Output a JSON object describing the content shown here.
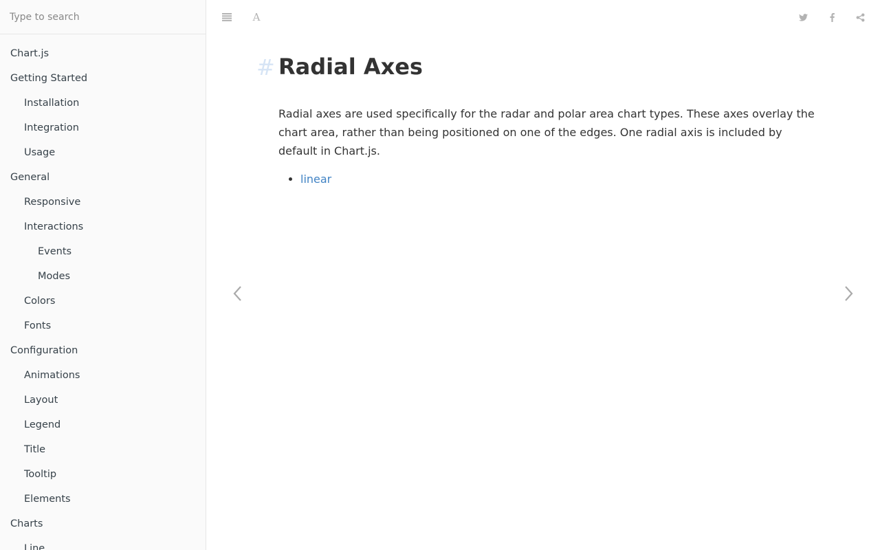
{
  "search": {
    "placeholder": "Type to search"
  },
  "sidebar": {
    "items": [
      {
        "label": "Chart.js",
        "level": 0
      },
      {
        "label": "Getting Started",
        "level": 0
      },
      {
        "label": "Installation",
        "level": 1
      },
      {
        "label": "Integration",
        "level": 1
      },
      {
        "label": "Usage",
        "level": 1
      },
      {
        "label": "General",
        "level": 0
      },
      {
        "label": "Responsive",
        "level": 1
      },
      {
        "label": "Interactions",
        "level": 1
      },
      {
        "label": "Events",
        "level": 2
      },
      {
        "label": "Modes",
        "level": 2
      },
      {
        "label": "Colors",
        "level": 1
      },
      {
        "label": "Fonts",
        "level": 1
      },
      {
        "label": "Configuration",
        "level": 0
      },
      {
        "label": "Animations",
        "level": 1
      },
      {
        "label": "Layout",
        "level": 1
      },
      {
        "label": "Legend",
        "level": 1
      },
      {
        "label": "Title",
        "level": 1
      },
      {
        "label": "Tooltip",
        "level": 1
      },
      {
        "label": "Elements",
        "level": 1
      },
      {
        "label": "Charts",
        "level": 0
      },
      {
        "label": "Line",
        "level": 1
      }
    ]
  },
  "header": {
    "toolbar_icons": [
      "menu-icon",
      "font-settings-icon"
    ],
    "share_icons": [
      "twitter-icon",
      "facebook-icon",
      "share-icon"
    ]
  },
  "page": {
    "anchor": "#",
    "title": "Radial Axes",
    "paragraph": "Radial axes are used specifically for the radar and polar area chart types. These axes overlay the chart area, rather than being positioned on one of the edges. One radial axis is included by default in Chart.js.",
    "links": [
      "linear"
    ]
  },
  "colors": {
    "link": "#4183c4",
    "sidebar_bg": "#fafafa",
    "icon": "#b3b3b3"
  }
}
